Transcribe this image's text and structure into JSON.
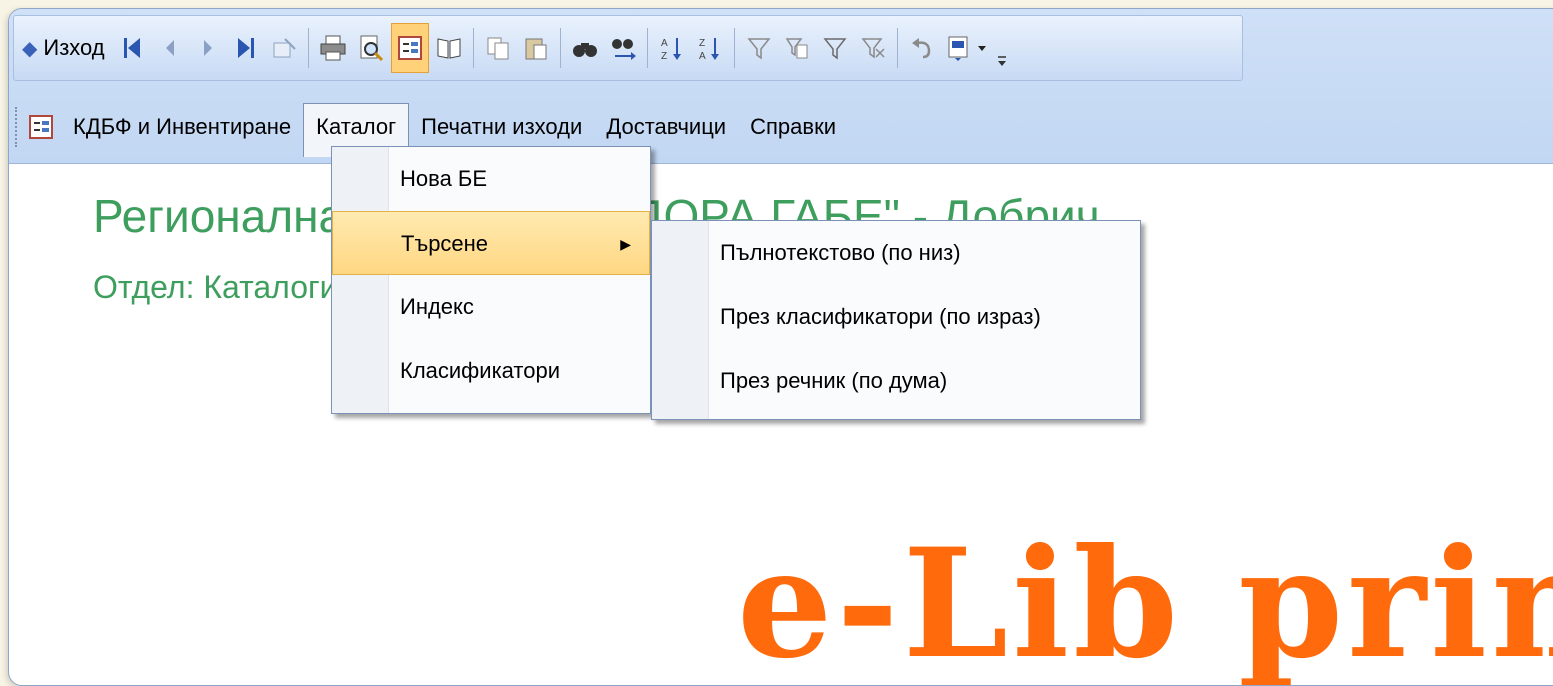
{
  "toolbar": {
    "exit_label": "Изход",
    "icons": [
      "first-record-icon",
      "prev-record-icon",
      "next-record-icon",
      "last-record-icon",
      "new-record-icon",
      "print-icon",
      "print-preview-icon",
      "form-view-icon",
      "book-icon",
      "copy-icon",
      "paste-icon",
      "find-icon",
      "find-next-icon",
      "sort-asc-icon",
      "sort-desc-icon",
      "filter-by-selection-icon",
      "filter-by-form-icon",
      "apply-filter-icon",
      "remove-filter-icon",
      "undo-icon",
      "export-word-icon"
    ]
  },
  "menubar": {
    "items": [
      {
        "label": "КДБФ и Инвентиране"
      },
      {
        "label": "Каталог"
      },
      {
        "label": "Печатни изходи"
      },
      {
        "label": "Доставчици"
      },
      {
        "label": "Справки"
      }
    ]
  },
  "main": {
    "title_line1": "Регионална библиотека \"ДОРА ГАБЕ\" - Добрич",
    "title_line2": "Отдел:  Каталогизация",
    "logo_text": "e-Lib prima"
  },
  "catalog_menu": {
    "items": [
      {
        "label": "Нова БЕ"
      },
      {
        "label": "Търсене"
      },
      {
        "label": "Индекс"
      },
      {
        "label": "Класификатори"
      }
    ]
  },
  "search_submenu": {
    "items": [
      {
        "label": "Пълнотекстово (по низ)"
      },
      {
        "label": "През класификатори (по израз)"
      },
      {
        "label": "През речник (по дума)"
      }
    ]
  },
  "colors": {
    "title_green": "#3e9e5e",
    "logo_orange": "#ff6a0c",
    "highlight": "#ffd783"
  }
}
